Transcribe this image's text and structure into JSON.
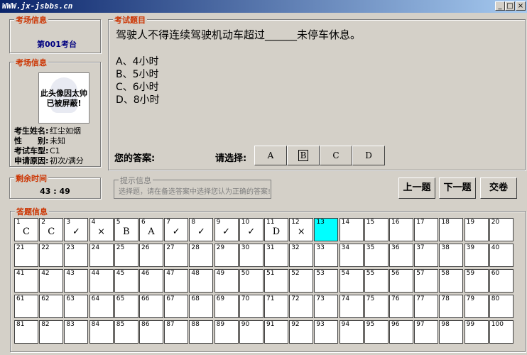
{
  "window": {
    "title": "WWW.jx-jsbbs.cn",
    "minimize": "_",
    "maximize": "□",
    "close": "×"
  },
  "exam_room": {
    "legend": "考场信息",
    "room": "第001考台"
  },
  "candidate": {
    "legend": "考场信息",
    "photo_note_line1": "此头像因太帅",
    "photo_note_line2": "已被屏蔽!",
    "fields": [
      {
        "label": "考生姓名:",
        "value": "红尘如烟"
      },
      {
        "label": "性　　别:",
        "value": "未知"
      },
      {
        "label": "考试车型:",
        "value": "C1"
      },
      {
        "label": "申请原因:",
        "value": "初次/满分"
      }
    ]
  },
  "timer": {
    "legend": "剩余时间",
    "value": "43 : 49"
  },
  "question": {
    "legend": "考试题目",
    "text": "驾驶人不得连续驾驶机动车超过______未停车休息。",
    "options": [
      "A、4小时",
      "B、5小时",
      "C、6小时",
      "D、8小时"
    ],
    "your_answer_label": "您的答案:",
    "your_answer_value": "",
    "select_label": "请选择:",
    "choices": [
      "A",
      "B",
      "C",
      "D"
    ],
    "selected": "B"
  },
  "hint": {
    "legend": "提示信息",
    "text": "选择题，请在备选答案中选择您认为正确的答案!"
  },
  "nav": {
    "prev": "上一题",
    "next": "下一题",
    "submit": "交卷"
  },
  "answers": {
    "legend": "答题信息",
    "current": 13,
    "marks": [
      "C",
      "C",
      "✓",
      "×",
      "B",
      "A",
      "✓",
      "✓",
      "✓",
      "✓",
      "D",
      "×"
    ]
  }
}
